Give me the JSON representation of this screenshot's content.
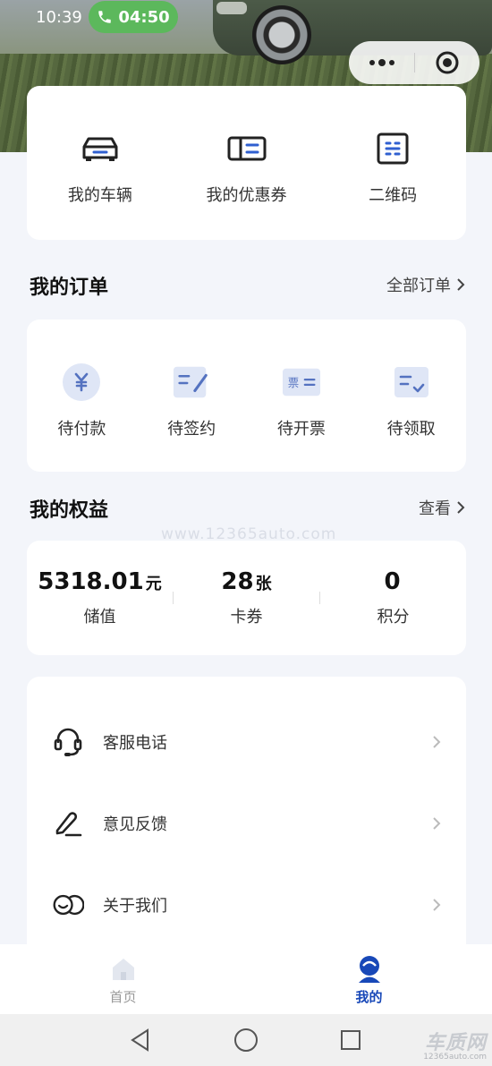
{
  "status_bar": {
    "time": "10:39",
    "call_timer": "04:50"
  },
  "quick_actions": [
    {
      "label": "我的车辆",
      "icon": "car-icon"
    },
    {
      "label": "我的优惠券",
      "icon": "coupon-icon"
    },
    {
      "label": "二维码",
      "icon": "qrcode-icon"
    }
  ],
  "orders": {
    "title": "我的订单",
    "link": "全部订单",
    "items": [
      {
        "label": "待付款",
        "icon": "yen-icon"
      },
      {
        "label": "待签约",
        "icon": "sign-icon"
      },
      {
        "label": "待开票",
        "icon": "invoice-icon",
        "glyph": "票"
      },
      {
        "label": "待领取",
        "icon": "receive-icon"
      }
    ]
  },
  "rights": {
    "title": "我的权益",
    "link": "查看",
    "stats": [
      {
        "value": "5318.01",
        "unit": "元",
        "caption": "储值"
      },
      {
        "value": "28",
        "unit": "张",
        "caption": "卡券"
      },
      {
        "value": "0",
        "unit": "",
        "caption": "积分"
      }
    ]
  },
  "watermark": "www.12365auto.com",
  "menu": [
    {
      "label": "客服电话",
      "icon": "headset-icon"
    },
    {
      "label": "意见反馈",
      "icon": "feedback-pen-icon"
    },
    {
      "label": "关于我们",
      "icon": "about-us-icon"
    }
  ],
  "tabbar": [
    {
      "label": "首页",
      "icon": "home-icon",
      "active": false
    },
    {
      "label": "我的",
      "icon": "profile-icon",
      "active": true
    }
  ],
  "brand": {
    "name": "车质网",
    "site": "12365auto.com"
  },
  "colors": {
    "accent": "#1848b8",
    "icon_tint": "#e3eaf8",
    "icon_stroke": "#5472c0",
    "call_green": "#5cb85c"
  }
}
